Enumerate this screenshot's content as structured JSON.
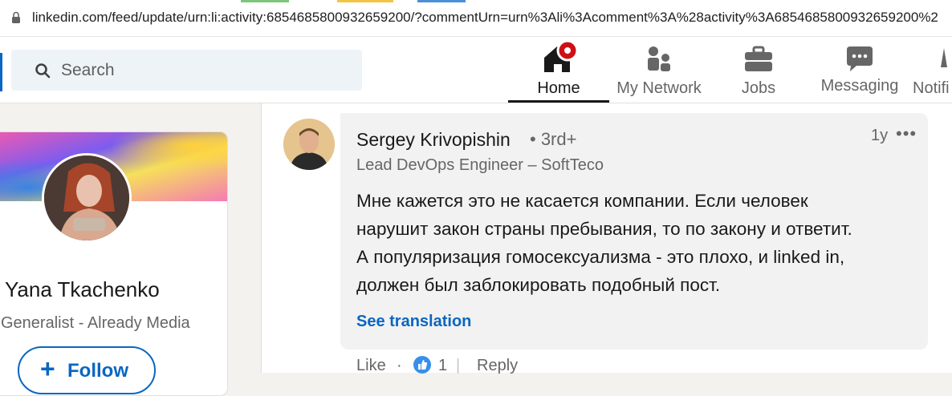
{
  "browser": {
    "url": "linkedin.com/feed/update/urn:li:activity:6854685800932659200/?commentUrn=urn%3Ali%3Acomment%3A%28activity%3A6854685800932659200%2"
  },
  "nav": {
    "search_placeholder": "Search",
    "items": [
      {
        "label": "Home",
        "icon": "home-icon"
      },
      {
        "label": "My Network",
        "icon": "my-network-icon"
      },
      {
        "label": "Jobs",
        "icon": "briefcase-icon"
      },
      {
        "label": "Messaging",
        "icon": "messaging-icon"
      },
      {
        "label": "Notifi",
        "icon": "bell-icon"
      }
    ],
    "active": "Home",
    "accent": "#0a66c2",
    "badge_color": "#cc1016"
  },
  "profile": {
    "name": "Yana Tkachenko",
    "title": "Generalist - Already Media",
    "follow_plus": "+",
    "follow_label": "Follow"
  },
  "comment": {
    "author": "Sergey Krivopishin",
    "degree": "• 3rd+",
    "headline": "Lead DevOps Engineer – SoftTeco",
    "time": "1y",
    "more": "•••",
    "lines": [
      "Мне кажется это не касается компании. Если человек",
      "нарушит закон страны пребывания, то по закону и ответит.",
      "А популяризация гомосексуализма - это плохо, и linked in,",
      "должен был заблокировать подобный пост."
    ],
    "see_translation": "See translation",
    "actions": {
      "like": "Like",
      "separator": "·",
      "reaction_count": "1",
      "divider": "|",
      "reply": "Reply"
    }
  }
}
